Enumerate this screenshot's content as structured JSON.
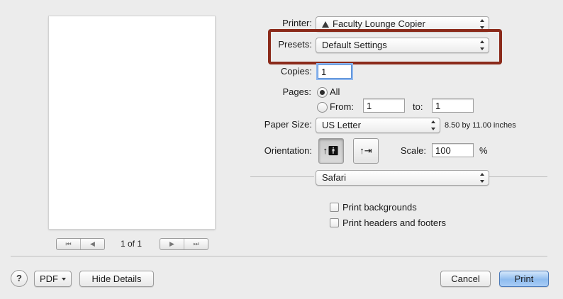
{
  "preview": {
    "page_indicator": "1 of 1",
    "nav": {
      "first": "⏮",
      "prev": "◀",
      "next": "▶",
      "last": "⏭"
    }
  },
  "printer": {
    "label": "Printer:",
    "value": "Faculty Lounge Copier"
  },
  "presets": {
    "label": "Presets:",
    "value": "Default Settings"
  },
  "copies": {
    "label": "Copies:",
    "value": "1"
  },
  "pages": {
    "label": "Pages:",
    "all_label": "All",
    "from_label": "From:",
    "from_value": "1",
    "to_label": "to:",
    "to_value": "1",
    "selected": "all"
  },
  "paper_size": {
    "label": "Paper Size:",
    "value": "US Letter",
    "dimensions": "8.50 by 11.00 inches"
  },
  "orientation": {
    "label": "Orientation:",
    "selected": "portrait"
  },
  "scale": {
    "label": "Scale:",
    "value": "100",
    "unit": "%"
  },
  "section_popup": {
    "value": "Safari"
  },
  "options": [
    {
      "label": "Print backgrounds",
      "checked": false
    },
    {
      "label": "Print headers and footers",
      "checked": false
    }
  ],
  "footer": {
    "help": "?",
    "pdf": "PDF",
    "hide_details": "Hide Details",
    "cancel": "Cancel",
    "print": "Print"
  },
  "colors": {
    "highlight": "#8b2a1a",
    "primary_button": "#8fbcef"
  }
}
